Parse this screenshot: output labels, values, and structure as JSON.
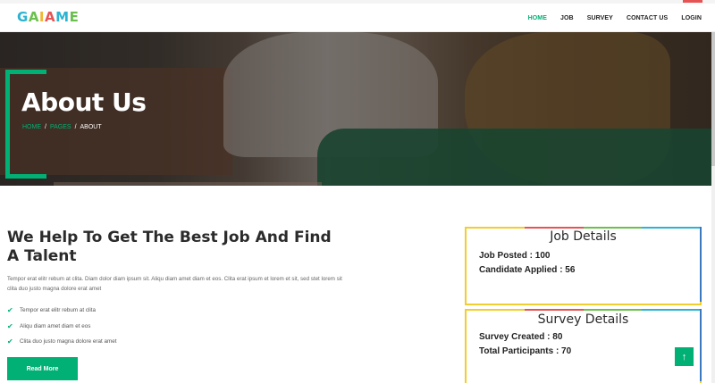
{
  "brand": {
    "logo_text": "GAIAME",
    "logo_letters": [
      {
        "ch": "G",
        "color": "#2bb3d1"
      },
      {
        "ch": "A",
        "color": "#6ac04c"
      },
      {
        "ch": "I",
        "color": "#f2b530"
      },
      {
        "ch": "A",
        "color": "#e55353"
      },
      {
        "ch": "M",
        "color": "#2bb3d1"
      },
      {
        "ch": "E",
        "color": "#6ac04c"
      }
    ]
  },
  "nav": {
    "items": [
      "HOME",
      "JOB",
      "SURVEY",
      "CONTACT US",
      "LOGIN"
    ],
    "active": "HOME"
  },
  "hero": {
    "title": "About Us",
    "breadcrumb": [
      "HOME",
      "PAGES",
      "ABOUT"
    ]
  },
  "about": {
    "heading": "We Help To Get The Best Job And Find A Talent",
    "paragraph": "Tempor erat elitr rebum at clita. Diam dolor diam ipsum sit. Aliqu diam amet diam et eos. Clita erat ipsum et lorem et sit, sed stet lorem sit clita duo justo magna dolore erat amet",
    "checks": [
      "Tempor erat elitr rebum at clita",
      "Aliqu diam amet diam et eos",
      "Clita duo justo magna dolore erat amet"
    ],
    "button": "Read More"
  },
  "job_card": {
    "title": "Job Details",
    "rows": [
      "Job Posted : 100",
      "Candidate Applied : 56"
    ]
  },
  "survey_card": {
    "title": "Survey Details",
    "rows": [
      "Survey Created : 80",
      "Total Participants : 70"
    ]
  },
  "colors": {
    "accent": "#00b074",
    "card_border": "#f2cd2e",
    "card_edge": "#3a78c0"
  },
  "icons": {
    "check": "check-icon",
    "back_to_top": "arrow-up-icon"
  }
}
